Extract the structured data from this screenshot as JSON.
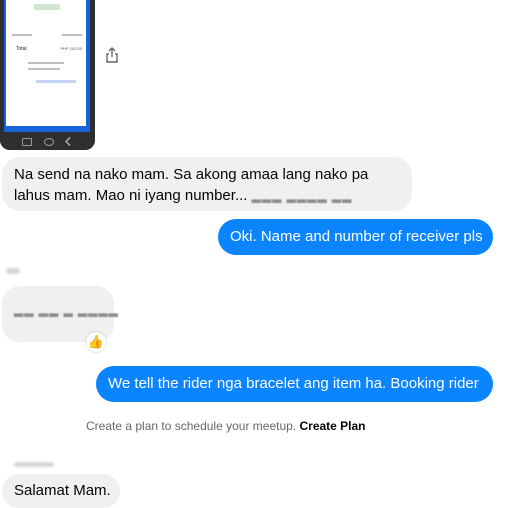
{
  "conversation": {
    "attachment": {
      "receipt_total_label": "Total",
      "receipt_total_value": "PHP 102.00"
    },
    "messages": [
      {
        "sender": "other",
        "line1": "Na send na nako mam. Sa akong amaa lang nako pa",
        "line2": "lahus mam. Mao ni iyang number..."
      },
      {
        "sender": "me",
        "text": "Oki. Name and number of receiver pls"
      },
      {
        "sender": "other",
        "line1": "",
        "line2": ""
      },
      {
        "sender": "me",
        "text": "We tell the rider nga bracelet ang item ha. Booking rider"
      },
      {
        "sender": "other",
        "text": "Salamat Mam."
      }
    ],
    "plan_prompt": {
      "text": "Create a plan to schedule your meetup.",
      "link_label": "Create Plan"
    },
    "reaction_emoji": "👍"
  },
  "colors": {
    "incoming_bubble": "#f0f0f0",
    "outgoing_bubble": "#0b84ff",
    "phone_accent": "#1565d8"
  }
}
